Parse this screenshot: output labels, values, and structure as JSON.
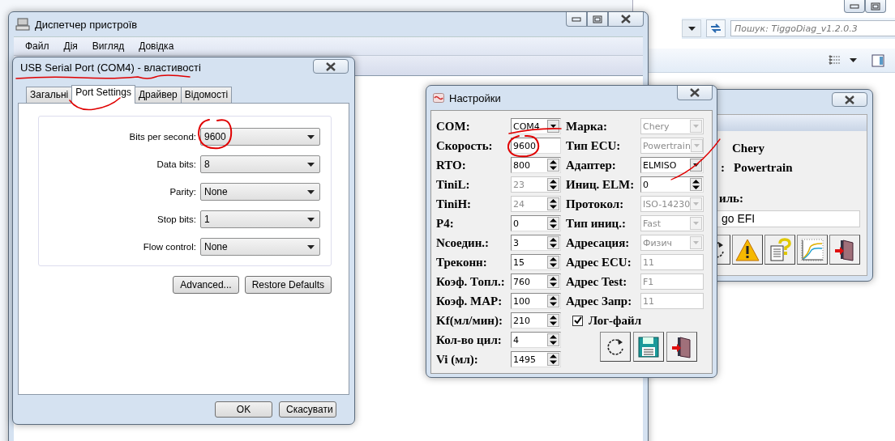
{
  "explorer": {
    "search": {
      "placeholder": "Пошук: TiggoDiag_v1.2.0.3"
    }
  },
  "device_manager": {
    "title": "Диспетчер пристроїв",
    "menu": [
      "Файл",
      "Дія",
      "Вигляд",
      "Довідка"
    ]
  },
  "properties_dialog": {
    "title": "USB Serial Port (COM4) - властивості",
    "tabs": [
      {
        "label": "Загальні",
        "selected": false
      },
      {
        "label": "Port Settings",
        "selected": true
      },
      {
        "label": "Драйвер",
        "selected": false
      },
      {
        "label": "Відомості",
        "selected": false
      }
    ],
    "fields": [
      {
        "label": "Bits per second:",
        "value": "9600"
      },
      {
        "label": "Data bits:",
        "value": "8"
      },
      {
        "label": "Parity:",
        "value": "None"
      },
      {
        "label": "Stop bits:",
        "value": "1"
      },
      {
        "label": "Flow control:",
        "value": "None"
      }
    ],
    "buttons": [
      "Advanced...",
      "Restore Defaults"
    ],
    "footer_buttons": [
      "OK",
      "Скасувати"
    ]
  },
  "settings_dialog": {
    "title": "Настройки",
    "left_fields": [
      {
        "label": "COM:",
        "kind": "combo",
        "value": "COM4",
        "disabled": false
      },
      {
        "label": "Скорость:",
        "kind": "text",
        "value": "9600",
        "disabled": false
      },
      {
        "label": "RTO:",
        "kind": "spin",
        "value": "800",
        "disabled": false
      },
      {
        "label": "TiniL:",
        "kind": "spin",
        "value": "23",
        "disabled": true
      },
      {
        "label": "TiniH:",
        "kind": "spin",
        "value": "24",
        "disabled": true
      },
      {
        "label": "P4:",
        "kind": "spin",
        "value": "0",
        "disabled": false
      },
      {
        "label": "Nсоедин.:",
        "kind": "spin",
        "value": "3",
        "disabled": false
      },
      {
        "label": "Треконн:",
        "kind": "spin",
        "value": "15",
        "disabled": false
      },
      {
        "label": "Коэф. Топл.:",
        "kind": "spin",
        "value": "760",
        "disabled": false
      },
      {
        "label": "Коэф. MAP:",
        "kind": "spin",
        "value": "100",
        "disabled": false
      },
      {
        "label": "Kf(мл/мин):",
        "kind": "spin",
        "value": "210",
        "disabled": false
      },
      {
        "label": "Кол-во цил:",
        "kind": "spin",
        "value": "4",
        "disabled": false
      },
      {
        "label": "Vi (мл):",
        "kind": "spin",
        "value": "1495",
        "disabled": false
      }
    ],
    "right_fields": [
      {
        "label": "Марка:",
        "kind": "combo",
        "value": "Chery",
        "disabled": true
      },
      {
        "label": "Тип ECU:",
        "kind": "combo",
        "value": "Powertrain",
        "disabled": true
      },
      {
        "label": "Адаптер:",
        "kind": "combo",
        "value": "ELMISO",
        "disabled": false
      },
      {
        "label": "Иниц. ELM:",
        "kind": "spin",
        "value": "0",
        "disabled": false
      },
      {
        "label": "Протокол:",
        "kind": "combo",
        "value": "ISO-14230",
        "disabled": true
      },
      {
        "label": "Тип иниц.:",
        "kind": "combo",
        "value": "Fast",
        "disabled": true
      },
      {
        "label": "Адресация:",
        "kind": "combo",
        "value": "Физич",
        "disabled": true
      },
      {
        "label": "Адрес ECU:",
        "kind": "text",
        "value": "11",
        "disabled": true
      },
      {
        "label": "Адрес Test:",
        "kind": "text",
        "value": "F1",
        "disabled": true
      },
      {
        "label": "Адрес Запр:",
        "kind": "text",
        "value": "11",
        "disabled": true
      }
    ],
    "log_file": {
      "label": "Лог-файл",
      "checked": true
    },
    "buttons": [
      {
        "kind": "refresh"
      },
      {
        "kind": "save"
      },
      {
        "kind": "exit"
      }
    ]
  },
  "main_window": {
    "make": "Chery",
    "ecu_label": ":",
    "ecu": "Powertrain",
    "profile_label": "иль:",
    "profile": "go EFI",
    "buttons": [
      {
        "kind": "refresh"
      },
      {
        "kind": "warning"
      },
      {
        "kind": "help"
      },
      {
        "kind": "chart"
      },
      {
        "kind": "exit"
      }
    ]
  },
  "annotations": [
    {
      "kind": "underline"
    },
    {
      "kind": "underline"
    },
    {
      "kind": "circle"
    },
    {
      "kind": "underline"
    },
    {
      "kind": "circle"
    },
    {
      "kind": "stroke"
    }
  ]
}
